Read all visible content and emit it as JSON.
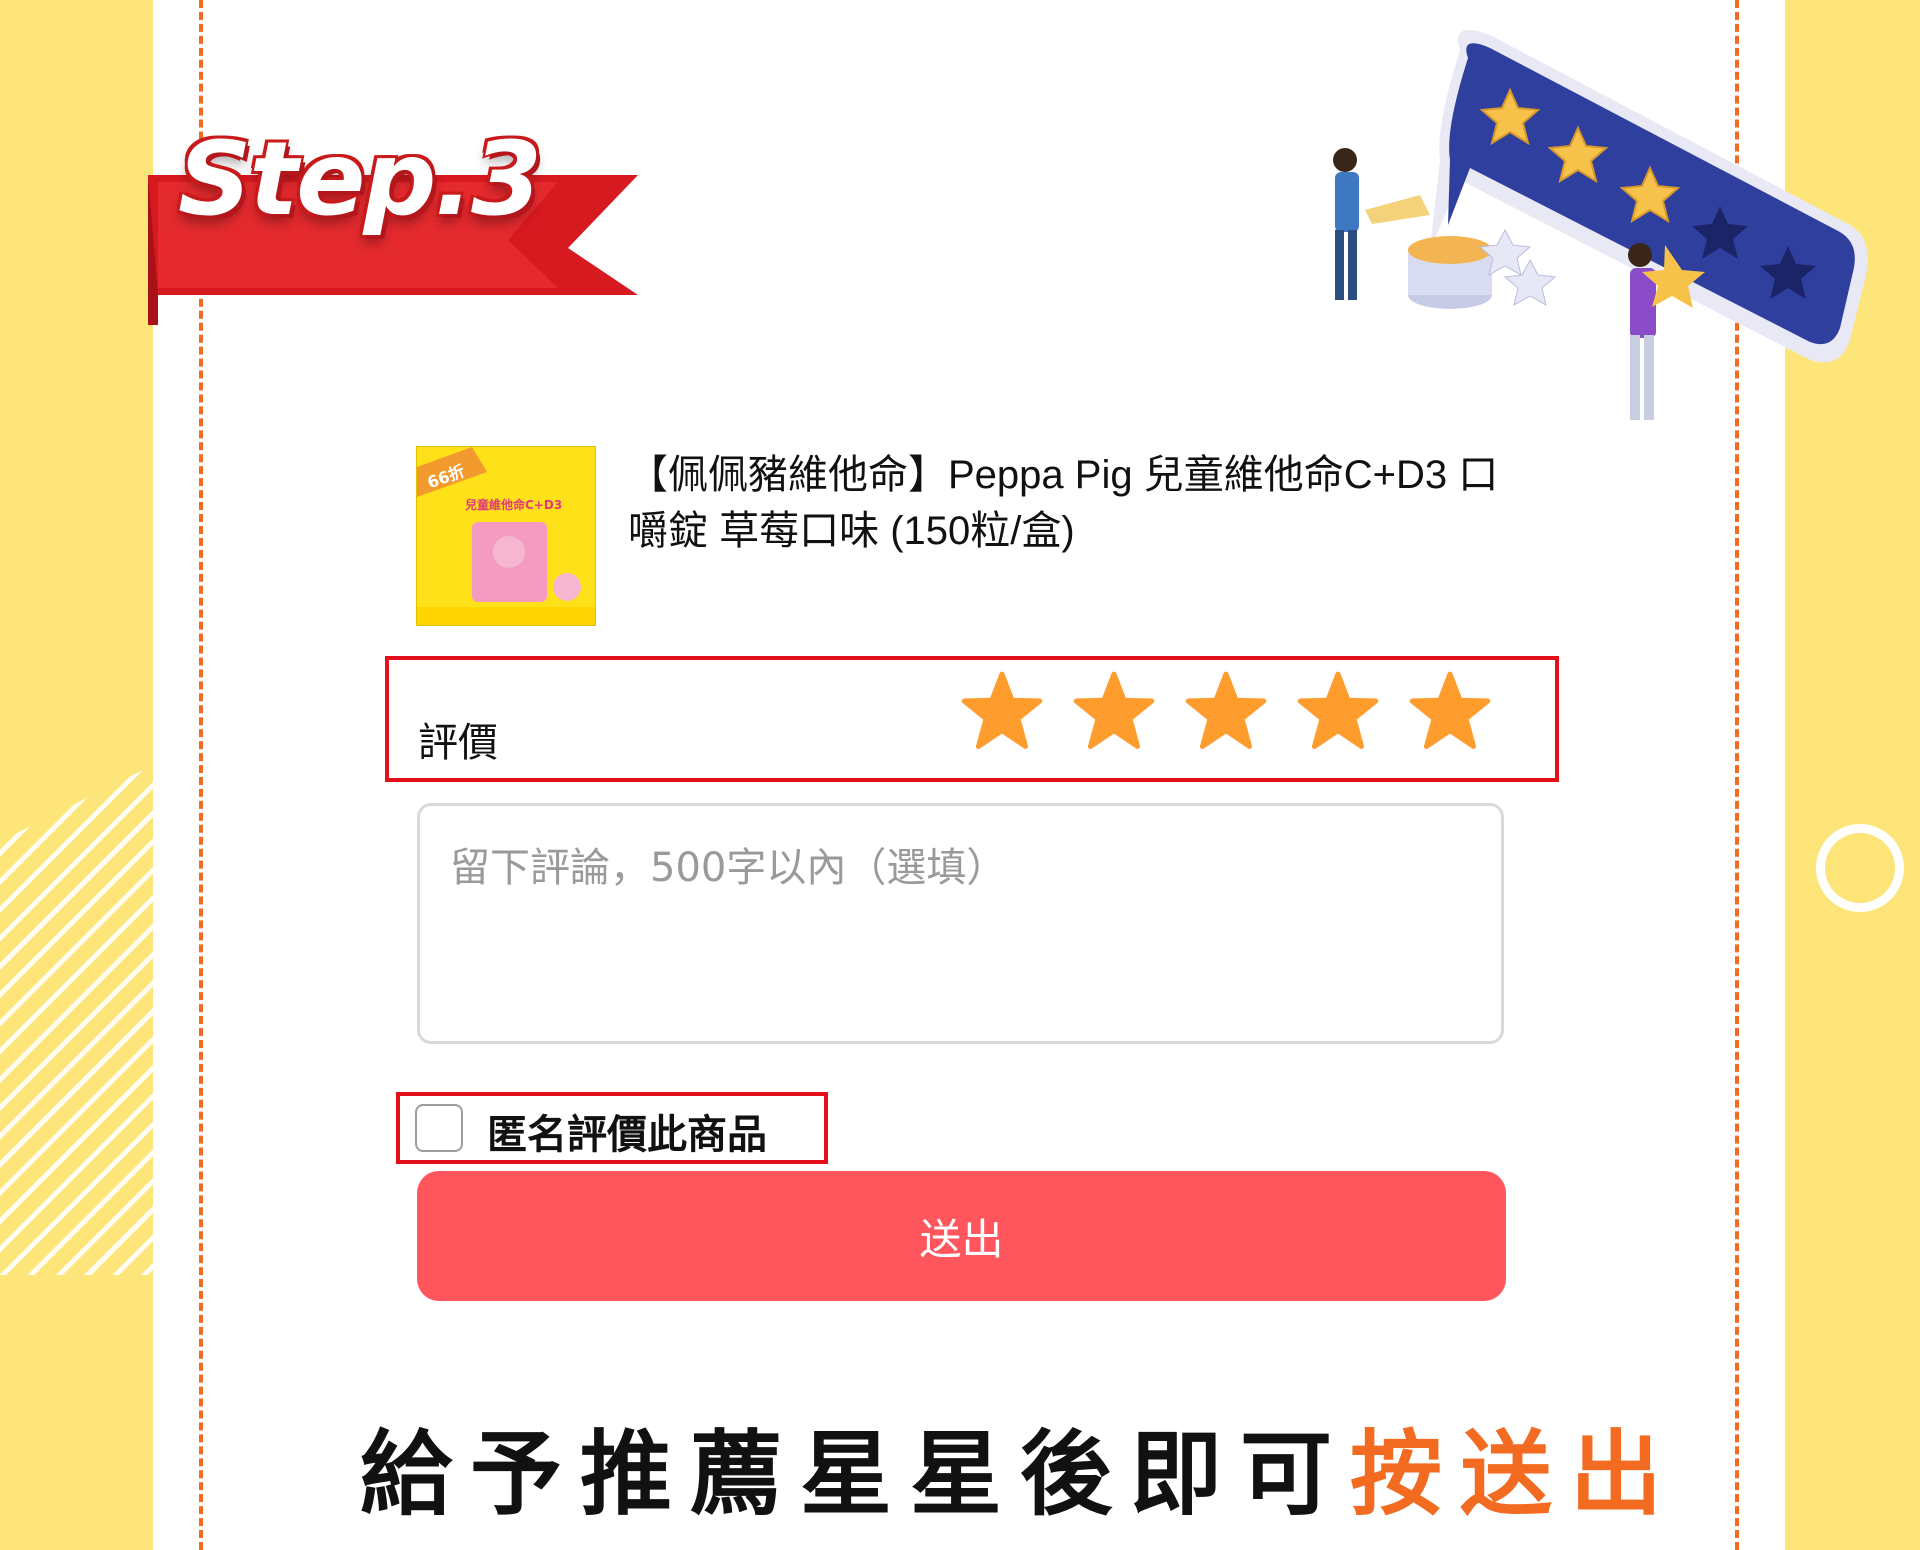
{
  "step": {
    "label": "Step.3"
  },
  "product": {
    "title": "【佩佩豬維他命】Peppa Pig 兒童維他命C+D3 口嚼錠 草莓口味 (150粒/盒)",
    "image_badge": "66折",
    "image_text": "兒童維他命C+D3"
  },
  "rating": {
    "label": "評價",
    "value": 5,
    "max": 5,
    "star_color": "#ff9c2e"
  },
  "comment": {
    "placeholder": "留下評論，500字以內（選填）"
  },
  "anonymous": {
    "label": "匿名評價此商品",
    "checked": false
  },
  "submit": {
    "label": "送出",
    "color": "#ff555c"
  },
  "caption": {
    "prefix": "給予推薦星星後即可",
    "highlight": "按送出",
    "highlight_color": "#f26b21"
  },
  "colors": {
    "background": "#fde57a",
    "dash": "#f26b21",
    "highlight_box": "#e3101b"
  }
}
